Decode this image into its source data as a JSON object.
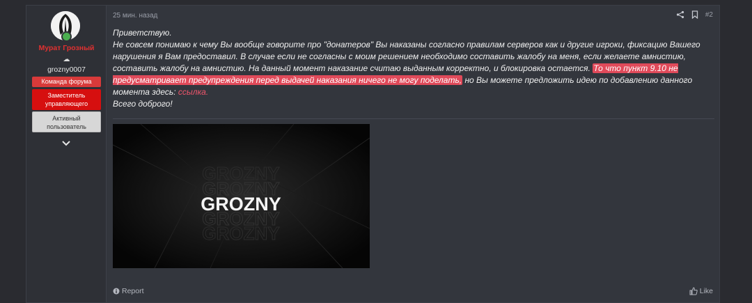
{
  "post": {
    "user": {
      "name": "Мурат Грозный",
      "online_icon": "cloud-icon",
      "online_symbol": "☁",
      "title": "grozny0007",
      "badges": [
        {
          "label": "Команда форума",
          "color": "#d83a3a"
        },
        {
          "label": "Заместитель управляющего",
          "color": "#d60f0f"
        },
        {
          "label": "Активный пользователь",
          "color": "#d7d7d7"
        }
      ]
    },
    "timestamp": "25 мин. назад",
    "post_number": "#2",
    "message": {
      "greeting": "Приветствую.",
      "body": "Не совсем понимаю к чему Вы вообще говорите про \"донатеров\" Вы наказаны согласно правилам серверов как и другие игроки, фиксацию Вашего нарушения я Вам предоставил. В случае если не согласны с моим решением необходимо составить жалобу на меня, если желаете амнистию, составить жалобу на амнистию. На данный момент наказание считаю выданным корректно, и блокировка остается.",
      "highlight": "То что пункт 9.10 не предусматривает предупреждения перед выдачей наказания ничего не могу поделать,",
      "after_highlight": " но Вы можете предложить идею по добавлению данного момента здесь: ",
      "link": "ссылка.",
      "closing": "Всего доброго!"
    },
    "banner": {
      "text": "GROZNY"
    },
    "actions": {
      "report": "Report",
      "like": "Like"
    }
  },
  "colors": {
    "page_bg": "#2a2b30",
    "post_bg": "#33363d",
    "username": "#e03030",
    "highlight": "#e04a5a",
    "link": "#f0566c"
  }
}
